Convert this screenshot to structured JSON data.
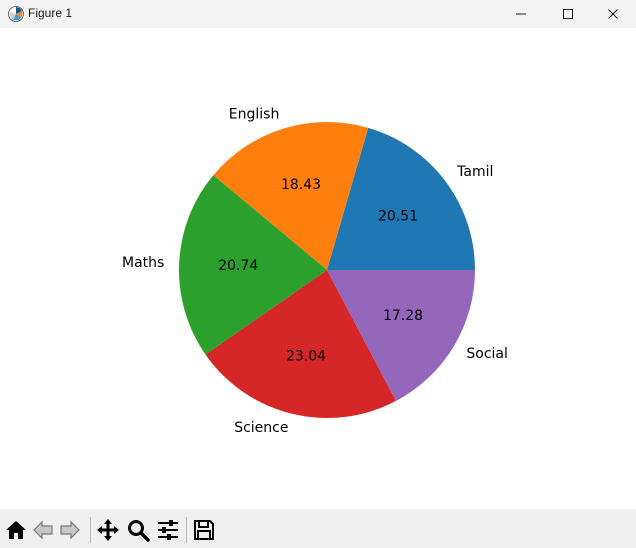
{
  "window": {
    "title": "Figure 1",
    "icons": [
      "matplotlib-logo-icon",
      "minimize-icon",
      "maximize-icon",
      "close-icon"
    ]
  },
  "toolbar": {
    "tools": [
      "home-icon",
      "back-icon",
      "forward-icon",
      "pan-icon",
      "zoom-icon",
      "configure-subplots-icon",
      "save-icon"
    ]
  },
  "chart_data": {
    "type": "pie",
    "title": "",
    "labels": [
      "Tamil",
      "English",
      "Maths",
      "Science",
      "Social"
    ],
    "values": [
      20.51,
      18.43,
      20.74,
      23.04,
      17.28
    ],
    "autopct_labels": [
      "20.51",
      "18.43",
      "20.74",
      "23.04",
      "17.28"
    ],
    "colors": [
      "#1f77b4",
      "#ff7f0e",
      "#2ca02c",
      "#d62728",
      "#9467bd"
    ],
    "start_angle_deg": 0,
    "direction": "counterclockwise"
  }
}
